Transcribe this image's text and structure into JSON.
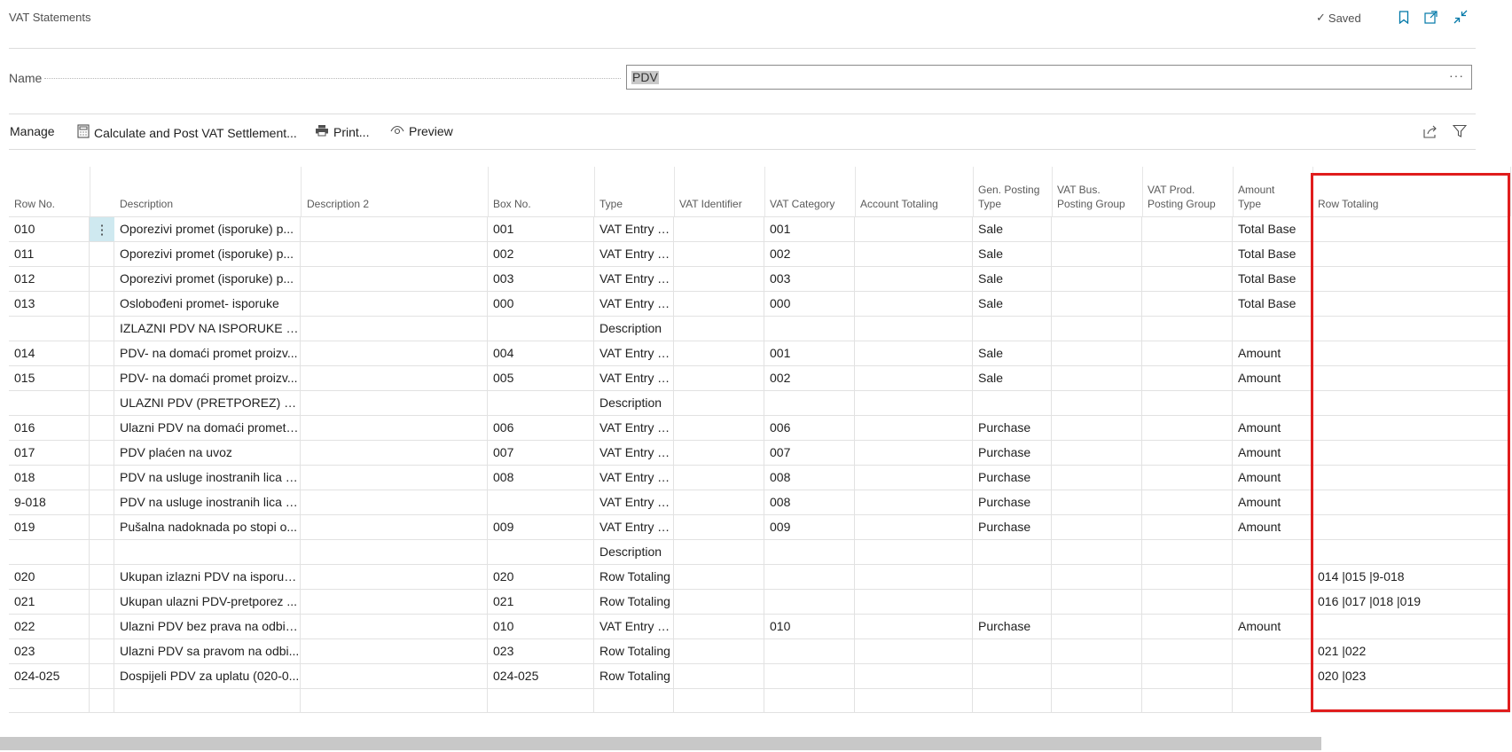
{
  "page": {
    "title": "VAT Statements",
    "saved_label": "Saved",
    "bookmark_icon": "bookmark-icon",
    "open_new_window_icon": "open-new-window-icon",
    "collapse_icon": "collapse-icon"
  },
  "name_field": {
    "label": "Name",
    "value": "PDV",
    "more_label": "···"
  },
  "actions": {
    "manage": "Manage",
    "calculate": "Calculate and Post VAT Settlement...",
    "print": "Print...",
    "preview": "Preview",
    "share_icon": "share-icon",
    "filter_icon": "filter-icon"
  },
  "table": {
    "columns": [
      {
        "key": "row_no",
        "label": "Row No."
      },
      {
        "key": "description",
        "label": "Description"
      },
      {
        "key": "description2",
        "label": "Description 2"
      },
      {
        "key": "box_no",
        "label": "Box No."
      },
      {
        "key": "type",
        "label": "Type"
      },
      {
        "key": "vat_identifier",
        "label": "VAT Identifier"
      },
      {
        "key": "vat_category",
        "label": "VAT Category"
      },
      {
        "key": "account_totaling",
        "label": "Account Totaling"
      },
      {
        "key": "gen_posting_type",
        "label": "Gen. Posting Type",
        "lines": [
          "Gen. Posting",
          "Type"
        ]
      },
      {
        "key": "vat_bus_posting_group",
        "label": "VAT Bus. Posting Group",
        "lines": [
          "VAT Bus.",
          "Posting Group"
        ]
      },
      {
        "key": "vat_prod_posting_group",
        "label": "VAT Prod. Posting Group",
        "lines": [
          "VAT Prod.",
          "Posting Group"
        ]
      },
      {
        "key": "amount_type",
        "label": "Amount Type",
        "lines": [
          "Amount",
          "Type"
        ]
      },
      {
        "key": "row_totaling",
        "label": "Row Totaling"
      }
    ],
    "rows": [
      {
        "row_no": "010",
        "description": "Oporezivi promet (isporuke) p...",
        "box_no": "001",
        "type": "VAT Entry T...",
        "vat_category": "001",
        "gen_posting_type": "Sale",
        "amount_type": "Total Base",
        "row_totaling": ""
      },
      {
        "row_no": "011",
        "description": "Oporezivi promet (isporuke) p...",
        "box_no": "002",
        "type": "VAT Entry T...",
        "vat_category": "002",
        "gen_posting_type": "Sale",
        "amount_type": "Total Base",
        "row_totaling": ""
      },
      {
        "row_no": "012",
        "description": "Oporezivi promet (isporuke) p...",
        "box_no": "003",
        "type": "VAT Entry T...",
        "vat_category": "003",
        "gen_posting_type": "Sale",
        "amount_type": "Total Base",
        "row_totaling": ""
      },
      {
        "row_no": "013",
        "description": "Oslobođeni promet- isporuke",
        "box_no": "000",
        "type": "VAT Entry T...",
        "vat_category": "000",
        "gen_posting_type": "Sale",
        "amount_type": "Total Base",
        "row_totaling": ""
      },
      {
        "row_no": "",
        "description": "IZLAZNI PDV NA ISPORUKE PR...",
        "box_no": "",
        "type": "Description",
        "vat_category": "",
        "gen_posting_type": "",
        "amount_type": "",
        "row_totaling": ""
      },
      {
        "row_no": "014",
        "description": "PDV- na domaći promet proizv...",
        "box_no": "004",
        "type": "VAT Entry T...",
        "vat_category": "001",
        "gen_posting_type": "Sale",
        "amount_type": "Amount",
        "row_totaling": ""
      },
      {
        "row_no": "015",
        "description": "PDV- na domaći promet proizv...",
        "box_no": "005",
        "type": "VAT Entry T...",
        "vat_category": "002",
        "gen_posting_type": "Sale",
        "amount_type": "Amount",
        "row_totaling": ""
      },
      {
        "row_no": "",
        "description": "ULAZNI PDV (PRETPOREZ) PRI ...",
        "box_no": "",
        "type": "Description",
        "vat_category": "",
        "gen_posting_type": "",
        "amount_type": "",
        "row_totaling": ""
      },
      {
        "row_no": "016",
        "description": "Ulazni PDV na domaći promet ...",
        "box_no": "006",
        "type": "VAT Entry T...",
        "vat_category": "006",
        "gen_posting_type": "Purchase",
        "amount_type": "Amount",
        "row_totaling": ""
      },
      {
        "row_no": "017",
        "description": "PDV plaćen na uvoz",
        "box_no": "007",
        "type": "VAT Entry T...",
        "vat_category": "007",
        "gen_posting_type": "Purchase",
        "amount_type": "Amount",
        "row_totaling": ""
      },
      {
        "row_no": "018",
        "description": "PDV na usluge inostranih lica -...",
        "box_no": "008",
        "type": "VAT Entry T...",
        "vat_category": "008",
        "gen_posting_type": "Purchase",
        "amount_type": "Amount",
        "row_totaling": ""
      },
      {
        "row_no": "9-018",
        "description": "PDV na usluge inostranih lica -...",
        "box_no": "",
        "type": "VAT Entry T...",
        "vat_category": "008",
        "gen_posting_type": "Purchase",
        "amount_type": "Amount",
        "row_totaling": ""
      },
      {
        "row_no": "019",
        "description": "Pušalna nadoknada po stopi o...",
        "box_no": "009",
        "type": "VAT Entry T...",
        "vat_category": "009",
        "gen_posting_type": "Purchase",
        "amount_type": "Amount",
        "row_totaling": ""
      },
      {
        "row_no": "",
        "description": "",
        "box_no": "",
        "type": "Description",
        "vat_category": "",
        "gen_posting_type": "",
        "amount_type": "",
        "row_totaling": ""
      },
      {
        "row_no": "020",
        "description": "Ukupan izlazni PDV na isporuk...",
        "box_no": "020",
        "type": "Row Totaling",
        "vat_category": "",
        "gen_posting_type": "",
        "amount_type": "",
        "row_totaling": "014 |015 |9-018"
      },
      {
        "row_no": "021",
        "description": "Ukupan ulazni PDV-pretporez ...",
        "box_no": "021",
        "type": "Row Totaling",
        "vat_category": "",
        "gen_posting_type": "",
        "amount_type": "",
        "row_totaling": "016 |017 |018 |019"
      },
      {
        "row_no": "022",
        "description": "Ulazni PDV bez prava na odbitak",
        "box_no": "010",
        "type": "VAT Entry T...",
        "vat_category": "010",
        "gen_posting_type": "Purchase",
        "amount_type": "Amount",
        "row_totaling": ""
      },
      {
        "row_no": "023",
        "description": "Ulazni PDV sa pravom na odbi...",
        "box_no": "023",
        "type": "Row Totaling",
        "vat_category": "",
        "gen_posting_type": "",
        "amount_type": "",
        "row_totaling": "021 |022"
      },
      {
        "row_no": "024-025",
        "description": "Dospijeli PDV za uplatu (020-0...",
        "box_no": "024-025",
        "type": "Row Totaling",
        "vat_category": "",
        "gen_posting_type": "",
        "amount_type": "",
        "row_totaling": "020 |023"
      },
      {
        "row_no": "",
        "description": "",
        "box_no": "",
        "type": "",
        "vat_category": "",
        "gen_posting_type": "",
        "amount_type": "",
        "row_totaling": ""
      }
    ],
    "row_menu_label": "⋮"
  },
  "colors": {
    "highlight_border": "#e01d1d",
    "row_menu_bg": "#cfe9f0",
    "accent": "#0078a8"
  }
}
